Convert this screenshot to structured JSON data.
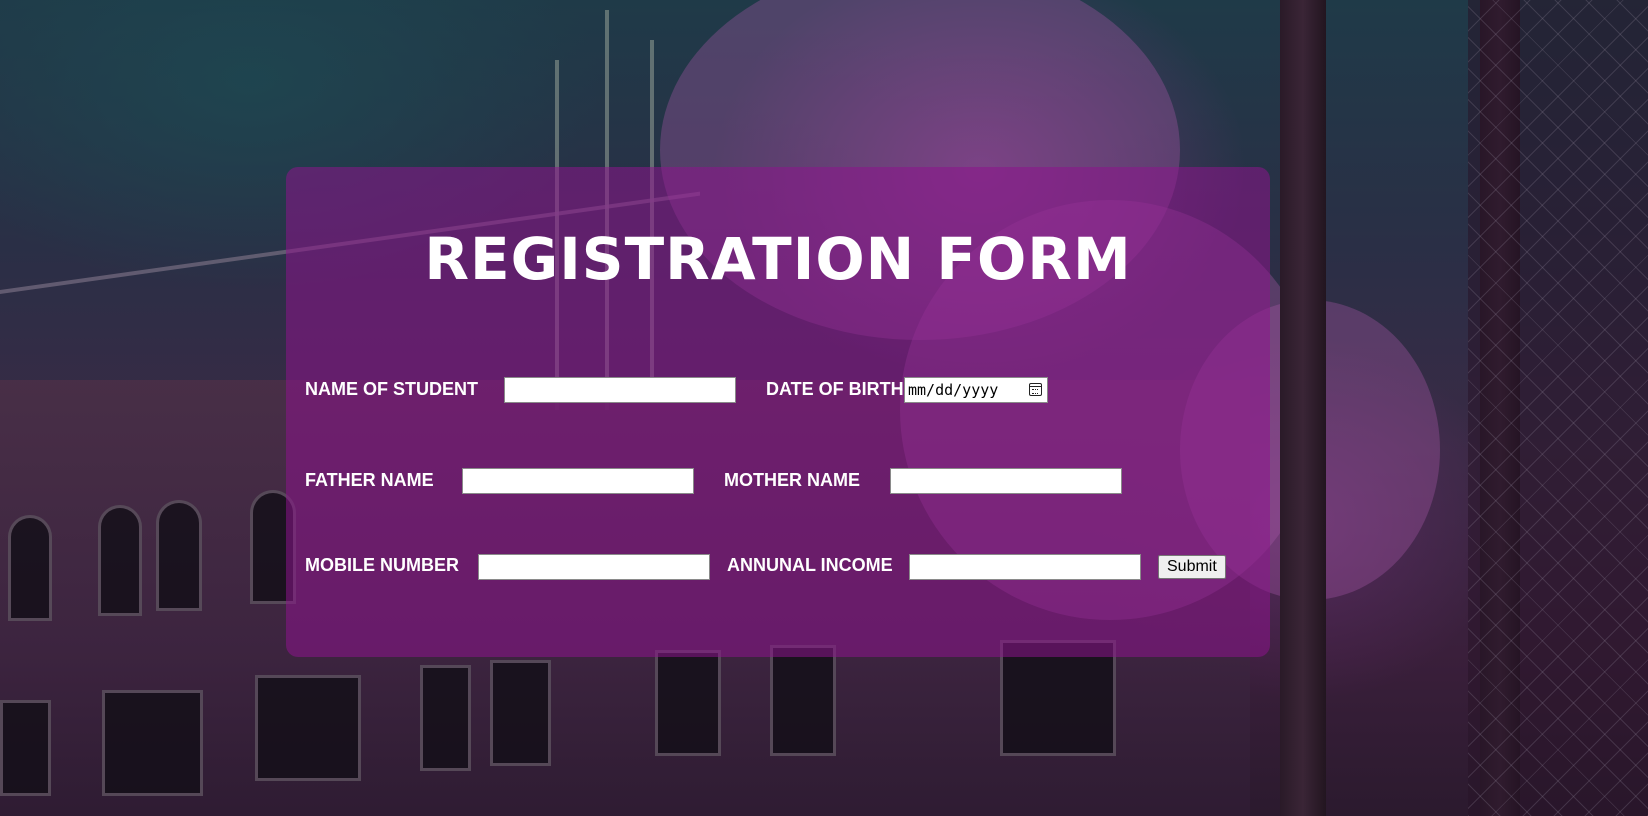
{
  "form": {
    "title": "REGISTRATION FORM",
    "labels": {
      "student_name": "NAME OF STUDENT",
      "dob": "DATE OF BIRTH",
      "father_name": "FATHER NAME",
      "mother_name": "MOTHER NAME",
      "mobile": "MOBILE NUMBER",
      "income": "ANNUNAL INCOME"
    },
    "values": {
      "student_name": "",
      "father_name": "",
      "mother_name": "",
      "mobile": "",
      "income": ""
    },
    "dob_placeholder": "mm/dd/yyyy",
    "submit_label": "Submit"
  },
  "icons": {
    "calendar": "calendar-icon"
  },
  "colors": {
    "panel": "#8c148c",
    "text": "#ffffff"
  }
}
